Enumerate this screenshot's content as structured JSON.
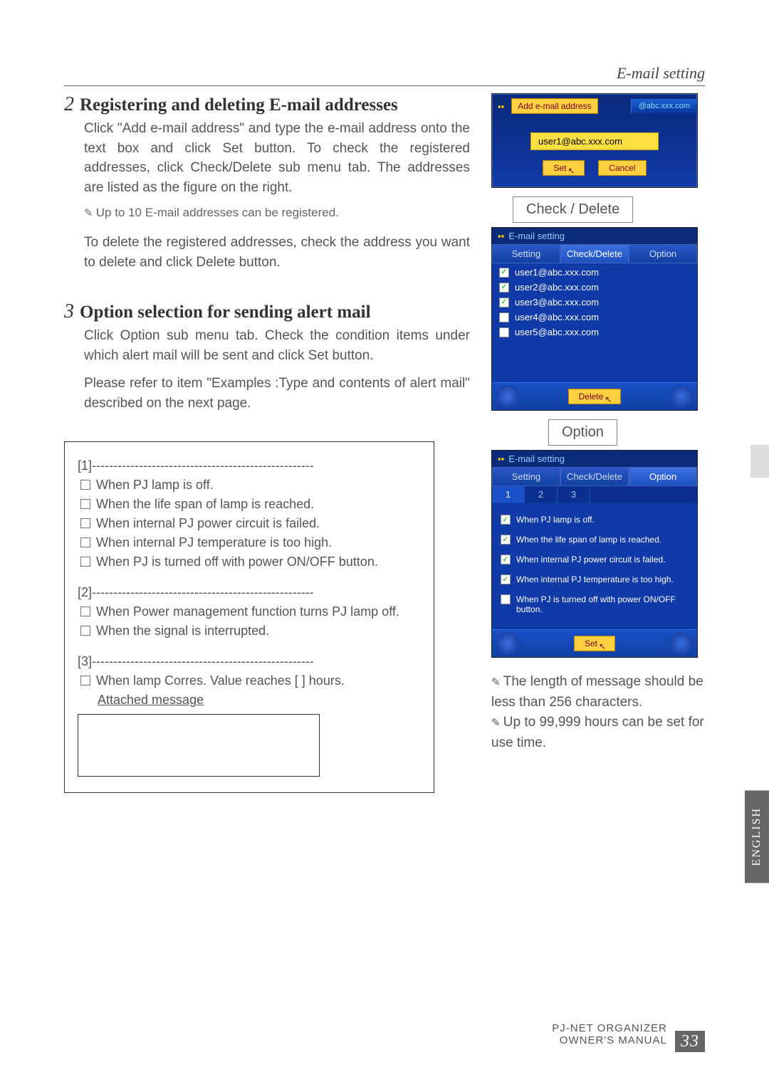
{
  "header_right": "E-mail setting",
  "sec2": {
    "num": "2",
    "title": "Registering and deleting E-mail addresses",
    "p1": "Click \"Add e-mail address\" and type the e-mail address onto the text box and click Set button. To check the registered addresses, click Check/Delete sub menu tab. The addresses are listed as the figure on the right.",
    "note1": "Up to 10 E-mail addresses can be registered.",
    "p2": "To delete the registered addresses, check the address you want to delete and click Delete button."
  },
  "sec3": {
    "num": "3",
    "title": "Option selection for sending alert mail",
    "p1": "Click Option sub menu tab. Check the condition items under which alert mail will be sent and click Set button.",
    "p2": "Please refer to item \"Examples :Type and contents of alert mail\" described on the next page."
  },
  "mini_add": {
    "btn": "Add e-mail address",
    "domain": "@abc.xxx.com",
    "input": "user1@abc.xxx.com",
    "set": "Set",
    "cancel": "Cancel"
  },
  "caption_checkdelete": "Check / Delete",
  "caption_option": "Option",
  "panel": {
    "title": "E-mail setting",
    "tabs": [
      "Setting",
      "Check/Delete",
      "Option"
    ],
    "users": [
      {
        "checked": true,
        "addr": "user1@abc.xxx.com"
      },
      {
        "checked": true,
        "addr": "user2@abc.xxx.com"
      },
      {
        "checked": true,
        "addr": "user3@abc.xxx.com"
      },
      {
        "checked": false,
        "addr": "user4@abc.xxx.com"
      },
      {
        "checked": false,
        "addr": "user5@abc.xxx.com"
      }
    ],
    "delete": "Delete"
  },
  "panel_opt": {
    "title": "E-mail setting",
    "tabs": [
      "Setting",
      "Check/Delete",
      "Option"
    ],
    "numtabs": [
      "1",
      "2",
      "3"
    ],
    "opts": [
      {
        "checked": true,
        "txt": "When PJ lamp is off."
      },
      {
        "checked": true,
        "txt": "When the life span of lamp is reached."
      },
      {
        "checked": true,
        "txt": "When internal PJ power circuit is failed."
      },
      {
        "checked": true,
        "txt": "When internal PJ temperature is too high."
      },
      {
        "checked": false,
        "txt": "When PJ is turned off with power ON/OFF button."
      }
    ],
    "set": "Set"
  },
  "boxed": {
    "g1": "[1]----------------------------------------------------",
    "g1items": [
      "When PJ lamp is off.",
      "When the life span of lamp is reached.",
      "When internal PJ power circuit is failed.",
      "When internal PJ temperature is too high.",
      "When PJ is turned off with power ON/OFF button."
    ],
    "g2": "[2]----------------------------------------------------",
    "g2items": [
      "When Power management function turns PJ lamp off.",
      "When the signal is interrupted."
    ],
    "g3": "[3]----------------------------------------------------",
    "g3item": "When lamp Corres. Value reaches [      ] hours.",
    "attached": "Attached message"
  },
  "footer_notes": {
    "n1": "The length of message should be less than 256 characters.",
    "n2": "Up to 99,999 hours can be set for use time."
  },
  "side_tab": "ENGLISH",
  "footer": {
    "label1": "PJ-NET ORGANIZER",
    "label2": "OWNER'S MANUAL",
    "page": "33"
  }
}
